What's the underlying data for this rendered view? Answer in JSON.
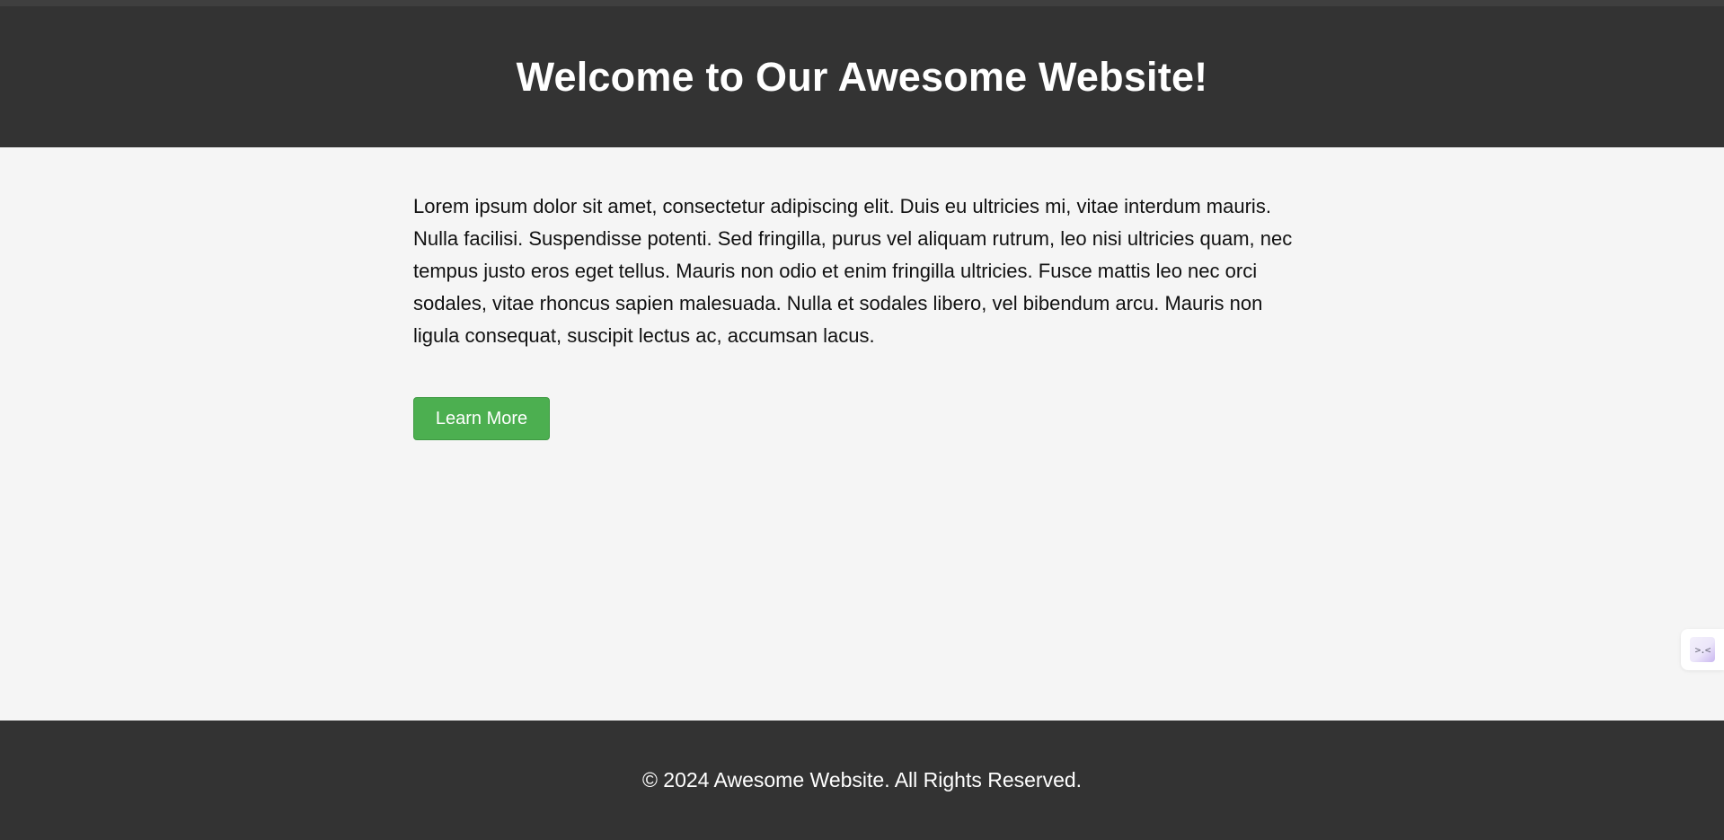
{
  "header": {
    "title": "Welcome to Our Awesome Website!"
  },
  "main": {
    "paragraph": "Lorem ipsum dolor sit amet, consectetur adipiscing elit. Duis eu ultricies mi, vitae interdum mauris. Nulla facilisi. Suspendisse potenti. Sed fringilla, purus vel aliquam rutrum, leo nisi ultricies quam, nec tempus justo eros eget tellus. Mauris non odio et enim fringilla ultricies. Fusce mattis leo nec orci sodales, vitae rhoncus sapien malesuada. Nulla et sodales libero, vel bibendum arcu. Mauris non ligula consequat, suscipit lectus ac, accumsan lacus.",
    "button_label": "Learn More"
  },
  "side_widget": {
    "icon": "face-icon",
    "glyph": ">.<"
  },
  "footer": {
    "text": "© 2024 Awesome Website. All Rights Reserved."
  },
  "colors": {
    "header_bg": "#333333",
    "page_bg": "#f5f5f5",
    "button_bg": "#4caf50",
    "text": "#111111",
    "inverse_text": "#ffffff"
  }
}
